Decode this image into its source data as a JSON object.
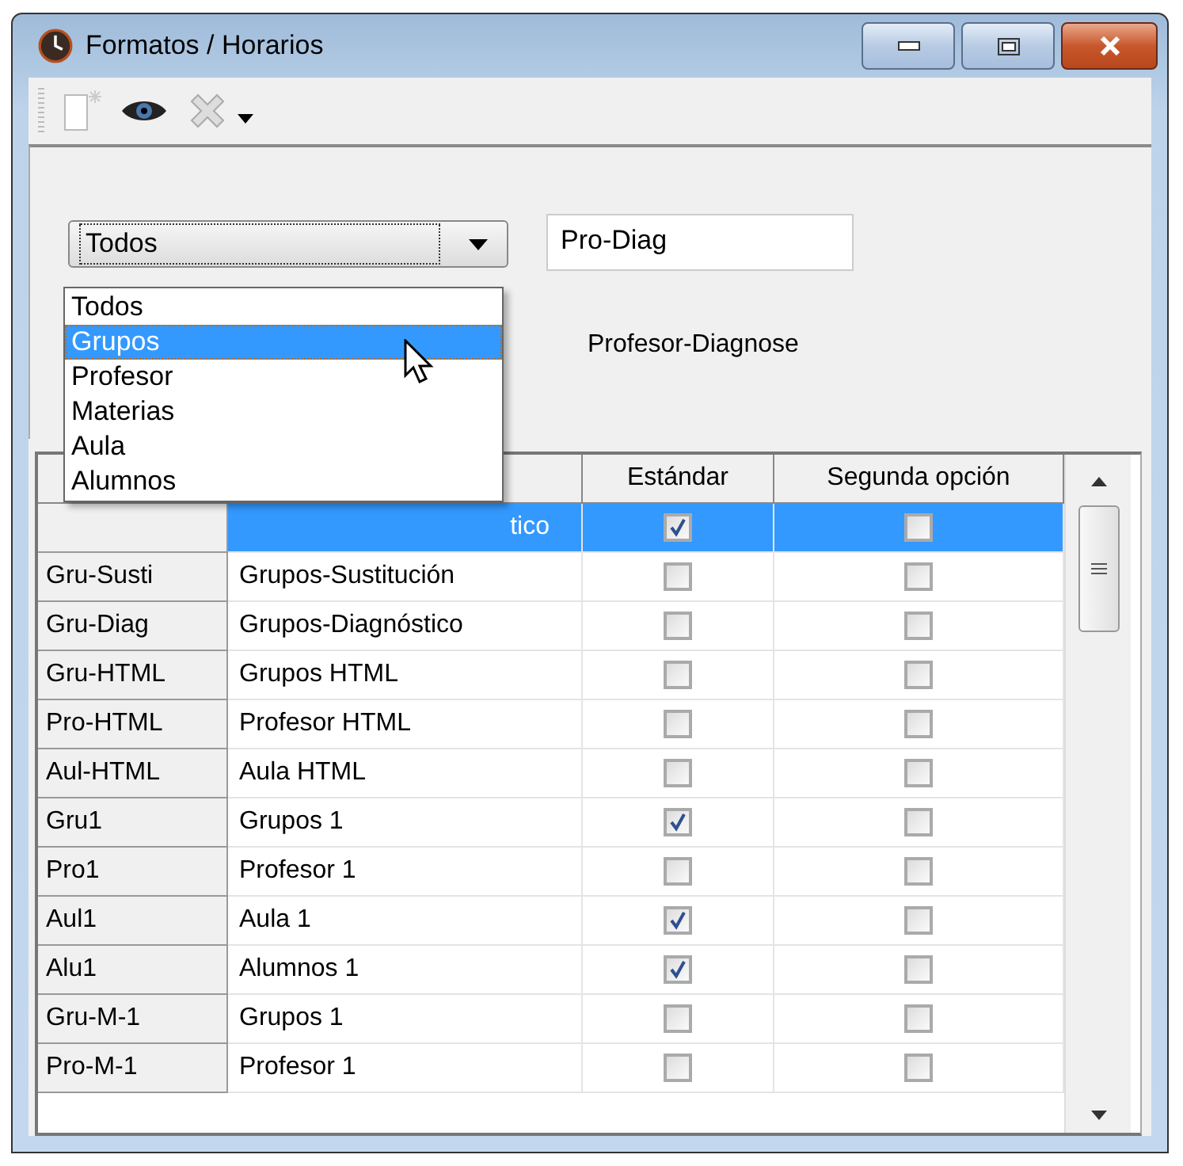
{
  "window": {
    "title": "Formatos / Horarios"
  },
  "toolbar": {
    "items": [
      {
        "kind": "new",
        "disabled": true
      },
      {
        "kind": "view",
        "disabled": false
      },
      {
        "kind": "delete",
        "disabled": true
      },
      {
        "kind": "more",
        "disabled": false
      }
    ]
  },
  "filter": {
    "combo_value": "Todos",
    "code_field": "Pro-Diag",
    "description": "Profesor-Diagnose",
    "dropdown": {
      "open": true,
      "options": [
        {
          "label": "Todos",
          "selected": false
        },
        {
          "label": "Grupos",
          "selected": true
        },
        {
          "label": "Profesor",
          "selected": false
        },
        {
          "label": "Materias",
          "selected": false
        },
        {
          "label": "Aula",
          "selected": false
        },
        {
          "label": "Alumnos",
          "selected": false
        }
      ]
    }
  },
  "table": {
    "columns": [
      {
        "label": "Estándar"
      },
      {
        "label": "Segunda opción"
      }
    ],
    "rows": [
      {
        "name": "tico",
        "selected": true,
        "standard": true,
        "second": false
      },
      {
        "code": "Gru-Susti",
        "name": "Grupos-Sustitución",
        "selected": false,
        "standard": false,
        "second": false
      },
      {
        "code": "Gru-Diag",
        "name": "Grupos-Diagnóstico",
        "selected": false,
        "standard": false,
        "second": false
      },
      {
        "code": "Gru-HTML",
        "name": "Grupos HTML",
        "selected": false,
        "standard": false,
        "second": false
      },
      {
        "code": "Pro-HTML",
        "name": "Profesor HTML",
        "selected": false,
        "standard": false,
        "second": false
      },
      {
        "code": "Aul-HTML",
        "name": "Aula HTML",
        "selected": false,
        "standard": false,
        "second": false
      },
      {
        "code": "Gru1",
        "name": "Grupos 1",
        "selected": false,
        "standard": true,
        "second": false
      },
      {
        "code": "Pro1",
        "name": "Profesor 1",
        "selected": false,
        "standard": false,
        "second": false
      },
      {
        "code": "Aul1",
        "name": "Aula 1",
        "selected": false,
        "standard": true,
        "second": false
      },
      {
        "code": "Alu1",
        "name": "Alumnos 1",
        "selected": false,
        "standard": true,
        "second": false
      },
      {
        "code": "Gru-M-1",
        "name": "Grupos 1",
        "selected": false,
        "standard": false,
        "second": false
      },
      {
        "code": "Pro-M-1",
        "name": "Profesor 1",
        "selected": false,
        "standard": false,
        "second": false
      }
    ]
  }
}
